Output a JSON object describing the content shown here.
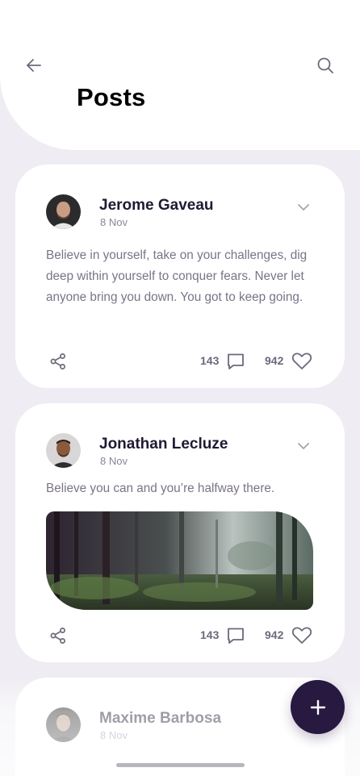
{
  "header": {
    "title": "Posts",
    "back_icon": "arrow-left-icon",
    "search_icon": "search-icon"
  },
  "posts": [
    {
      "author": "Jerome Gaveau",
      "date": "8 Nov",
      "text": "Believe in yourself, take on your challenges, dig deep within yourself to conquer fears. Never let anyone bring you down. You got to keep going.",
      "comments": "143",
      "likes": "942"
    },
    {
      "author": "Jonathan Lecluze",
      "date": "8 Nov",
      "text": "Believe you can and you’re halfway there.",
      "comments": "143",
      "likes": "942",
      "image": "forest-photo"
    },
    {
      "author": "Maxime Barbosa",
      "date": "8 Nov"
    }
  ],
  "fab": {
    "icon": "plus-icon"
  },
  "colors": {
    "background": "#efedf3",
    "card": "#ffffff",
    "fab": "#27193f",
    "name": "#211a33",
    "body_text": "#7b7388",
    "icon": "#6f687b"
  }
}
